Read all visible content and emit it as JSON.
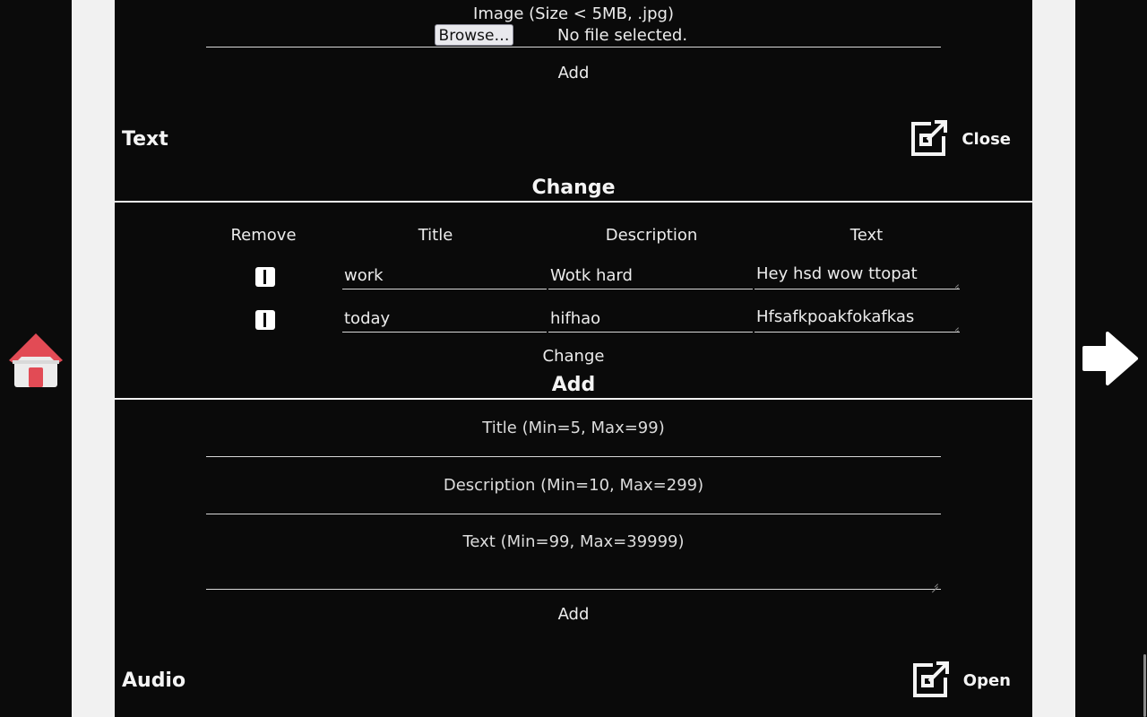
{
  "image_upload": {
    "label": "Image (Size < 5MB, .jpg)",
    "browse_label": "Browse…",
    "file_status": "No file selected.",
    "add_label": "Add"
  },
  "text_section": {
    "title": "Text",
    "toggle_label": "Close",
    "change": {
      "heading": "Change",
      "columns": [
        "Remove",
        "Title",
        "Description",
        "Text"
      ],
      "rows": [
        {
          "title": "work",
          "description": "Wotk hard",
          "text": "Hey hsd wow ttopat"
        },
        {
          "title": "today",
          "description": "hifhao",
          "text": "Hfsafkpoakfokafkas"
        }
      ],
      "submit_label": "Change"
    },
    "add": {
      "heading": "Add",
      "title_placeholder": "Title (Min=5, Max=99)",
      "description_placeholder": "Description (Min=10, Max=299)",
      "text_placeholder": "Text (Min=99, Max=39999)",
      "submit_label": "Add"
    }
  },
  "audio_section": {
    "title": "Audio",
    "toggle_label": "Open"
  },
  "icons": {
    "home": "home-icon",
    "next": "arrow-right-icon",
    "external": "open-external-icon"
  },
  "colors": {
    "background": "#0a0a0a",
    "gutter": "#f1f1f1",
    "home_roof": "#e24b55"
  }
}
